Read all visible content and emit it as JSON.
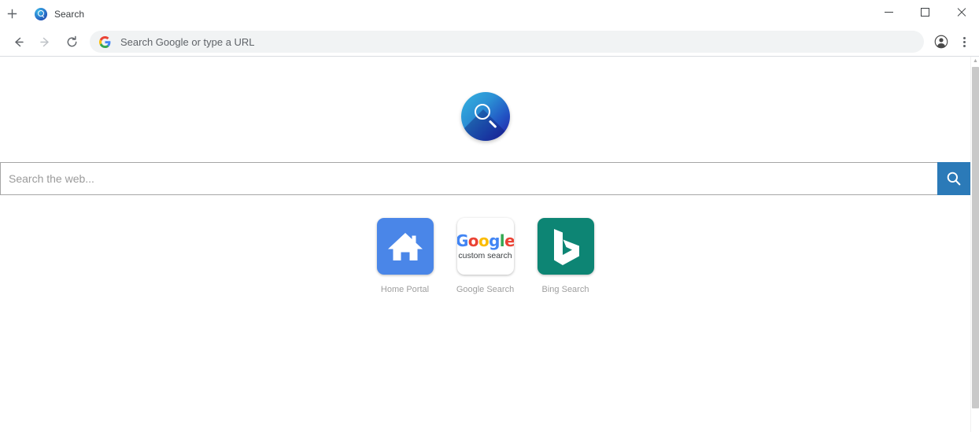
{
  "browser": {
    "new_tab_label": "+",
    "tab": {
      "title": "Search",
      "favicon": "search-globe-icon"
    },
    "window_controls": {
      "minimize": "minimize-icon",
      "maximize": "maximize-icon",
      "close": "close-icon"
    },
    "toolbar": {
      "back": "back-arrow-icon",
      "forward": "forward-arrow-icon",
      "reload": "reload-icon",
      "omnibox_placeholder": "Search Google or type a URL",
      "omnibox_value": "",
      "omnibox_icon": "google-g-icon",
      "profile": "profile-avatar-icon",
      "menu": "three-dot-menu-icon"
    }
  },
  "page": {
    "logo": {
      "name": "magnifier-logo",
      "alt": "Search"
    },
    "search": {
      "placeholder": "Search the web...",
      "value": "",
      "button_icon": "search-icon",
      "button_color": "#2b7ab8"
    },
    "shortcuts": [
      {
        "label": "Home Portal",
        "icon": "home-icon",
        "color": "#4a86e8"
      },
      {
        "label": "Google Search",
        "icon": "google-custom-search-icon",
        "color": "#ffffff",
        "google_word": [
          "G",
          "o",
          "o",
          "g",
          "l",
          "e"
        ],
        "google_sub": "custom search"
      },
      {
        "label": "Bing Search",
        "icon": "bing-icon",
        "color": "#0d8574"
      }
    ],
    "scrollbar": {
      "up": "▲",
      "down": "▼"
    }
  }
}
